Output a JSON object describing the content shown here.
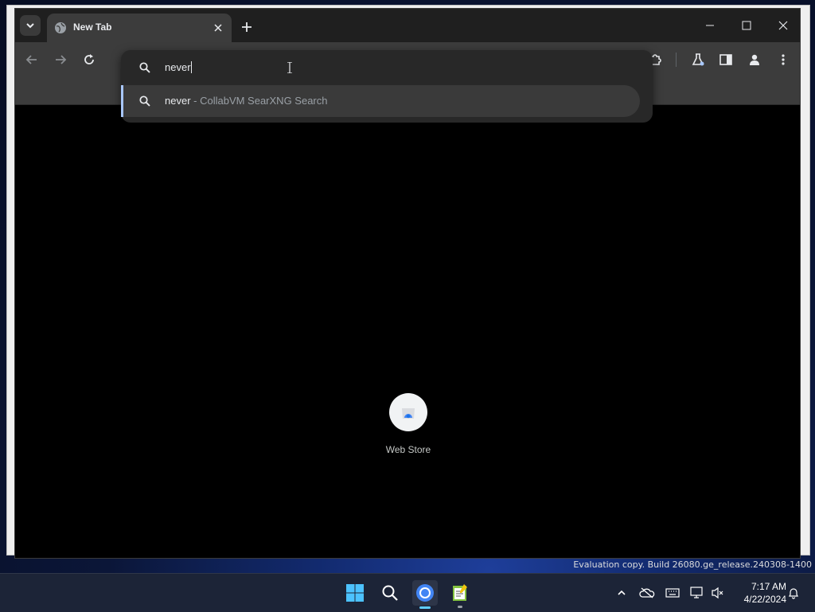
{
  "browser": {
    "tab": {
      "title": "New Tab"
    },
    "omnibox": {
      "value": "never",
      "suggestion": {
        "query": "never",
        "source": " - CollabVM SearXNG Search"
      }
    }
  },
  "new_tab_page": {
    "shortcuts": [
      {
        "label": "Web Store"
      }
    ]
  },
  "desktop": {
    "watermark": "Evaluation copy. Build 26080.ge_release.240308-1400"
  },
  "taskbar": {
    "apps": [
      "start-icon",
      "search-icon",
      "chrome-icon",
      "notepad-icon"
    ],
    "clock": {
      "time": "7:17 AM",
      "date": "4/22/2024"
    }
  },
  "colors": {
    "accent": "#a8c7fa",
    "toolbar": "#3c3c3c",
    "tabstrip": "#1f1f1f",
    "taskbar_active": "#60cdff"
  }
}
